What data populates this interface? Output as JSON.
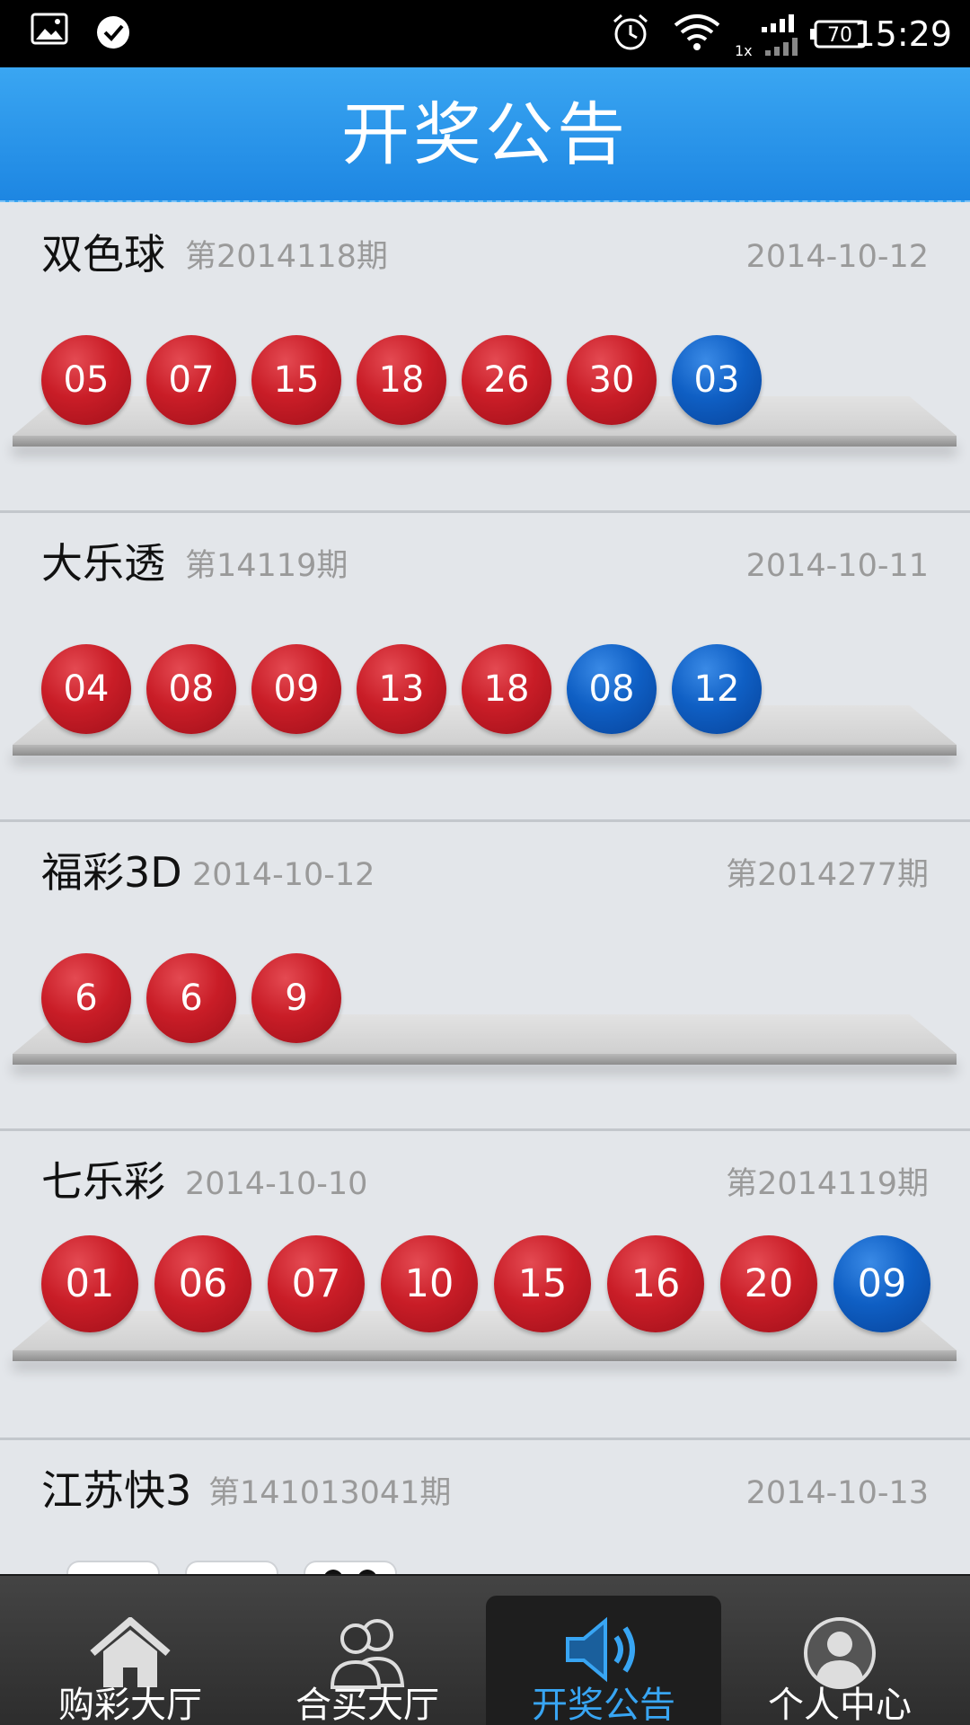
{
  "status_bar": {
    "time": "15:29",
    "battery": "70",
    "signal_label": "1x",
    "icons": [
      "gallery-icon",
      "check-circle-icon",
      "alarm-icon",
      "wifi-icon",
      "signal-icon",
      "battery-icon"
    ]
  },
  "header": {
    "title": "开奖公告"
  },
  "cards": [
    {
      "name": "双色球",
      "sub": "第2014118期",
      "right": "2014-10-12",
      "balls": [
        {
          "n": "05",
          "c": "red"
        },
        {
          "n": "07",
          "c": "red"
        },
        {
          "n": "15",
          "c": "red"
        },
        {
          "n": "18",
          "c": "red"
        },
        {
          "n": "26",
          "c": "red"
        },
        {
          "n": "30",
          "c": "red"
        },
        {
          "n": "03",
          "c": "blue"
        }
      ]
    },
    {
      "name": "大乐透",
      "sub": "第14119期",
      "right": "2014-10-11",
      "balls": [
        {
          "n": "04",
          "c": "red"
        },
        {
          "n": "08",
          "c": "red"
        },
        {
          "n": "09",
          "c": "red"
        },
        {
          "n": "13",
          "c": "red"
        },
        {
          "n": "18",
          "c": "red"
        },
        {
          "n": "08",
          "c": "blue"
        },
        {
          "n": "12",
          "c": "blue"
        }
      ]
    },
    {
      "name": "福彩3D",
      "sub": "2014-10-12",
      "right": "第2014277期",
      "balls": [
        {
          "n": "6",
          "c": "red"
        },
        {
          "n": "6",
          "c": "red"
        },
        {
          "n": "9",
          "c": "red"
        }
      ]
    },
    {
      "name": "七乐彩",
      "sub": "2014-10-10",
      "right": "第2014119期",
      "balls": [
        {
          "n": "01",
          "c": "red"
        },
        {
          "n": "06",
          "c": "red"
        },
        {
          "n": "07",
          "c": "red"
        },
        {
          "n": "10",
          "c": "red"
        },
        {
          "n": "15",
          "c": "red"
        },
        {
          "n": "16",
          "c": "red"
        },
        {
          "n": "20",
          "c": "red"
        },
        {
          "n": "09",
          "c": "blue"
        }
      ]
    },
    {
      "name": "江苏快3",
      "sub": "第141013041期",
      "right": "2014-10-13",
      "balls": []
    }
  ],
  "tabs": [
    {
      "label": "购彩大厅",
      "icon": "home-icon",
      "active": false
    },
    {
      "label": "合买大厅",
      "icon": "group-icon",
      "active": false
    },
    {
      "label": "开奖公告",
      "icon": "speaker-icon",
      "active": true
    },
    {
      "label": "个人中心",
      "icon": "user-icon",
      "active": false
    }
  ],
  "colors": {
    "header": "#2d9bee",
    "ball_red": "#c91d27",
    "ball_blue": "#0f5fc4",
    "tab_active": "#38a5f3",
    "background": "#e3e6ea"
  }
}
